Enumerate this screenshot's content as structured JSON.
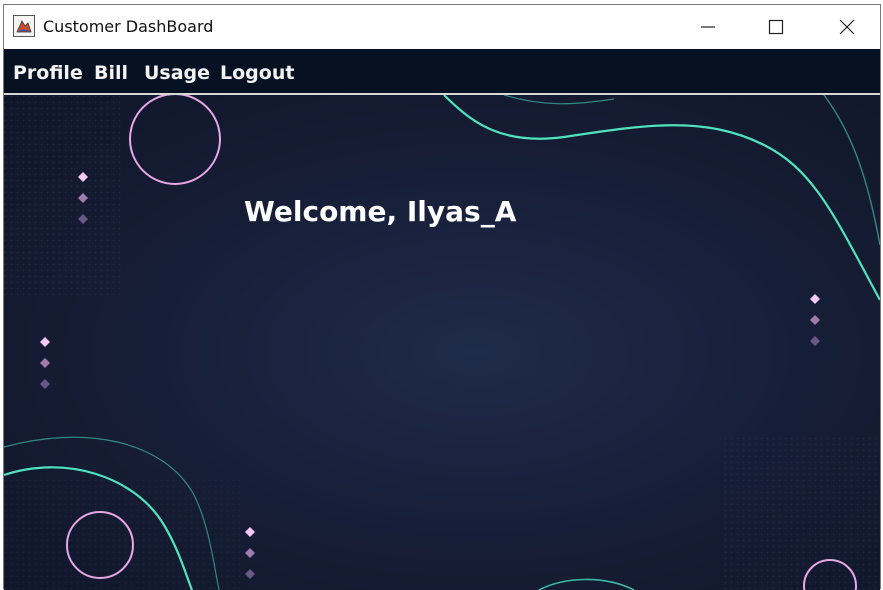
{
  "window": {
    "title": "Customer DashBoard",
    "controls": {
      "minimize_icon": "minimize-icon",
      "maximize_icon": "maximize-icon",
      "close_icon": "close-icon"
    }
  },
  "menu": {
    "items": [
      {
        "label": "Profile"
      },
      {
        "label": "Bill"
      },
      {
        "label": "Usage"
      },
      {
        "label": "Logout"
      }
    ]
  },
  "main": {
    "welcome": "Welcome, Ilyas_A"
  },
  "colors": {
    "menubar_bg": "#061222",
    "content_bg": "#151c33",
    "accent_teal": "#4ee0c0",
    "accent_pink": "#e7a6e6"
  }
}
